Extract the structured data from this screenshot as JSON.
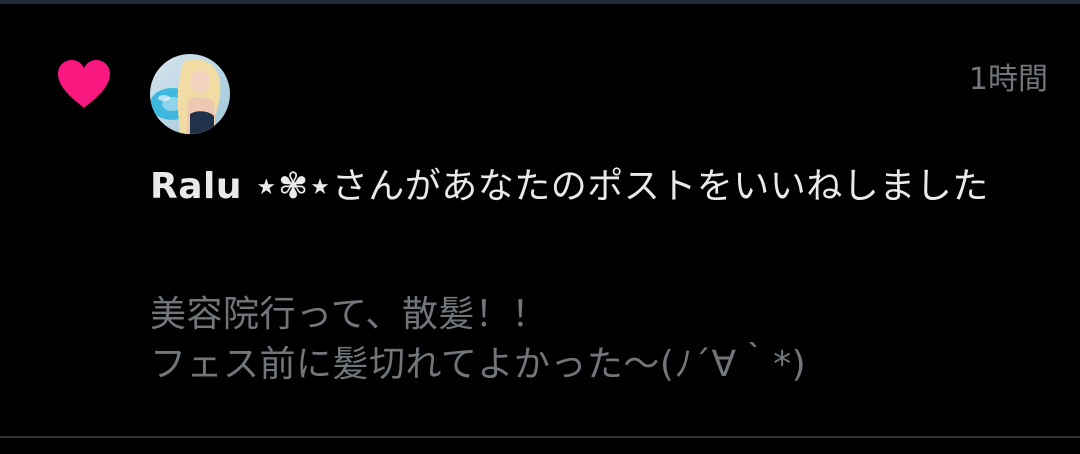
{
  "notification": {
    "icon": "heart-icon",
    "icon_color": "#f91880",
    "time": "1時間",
    "user_name": "Ralu ⋆✾⋆",
    "action_text": "さんがあなたのポストをいいねしました",
    "post_text_lines": [
      "美容院行って、散髪！！",
      "フェス前に髪切れてよかった〜(ﾉ´∀｀*)"
    ]
  }
}
